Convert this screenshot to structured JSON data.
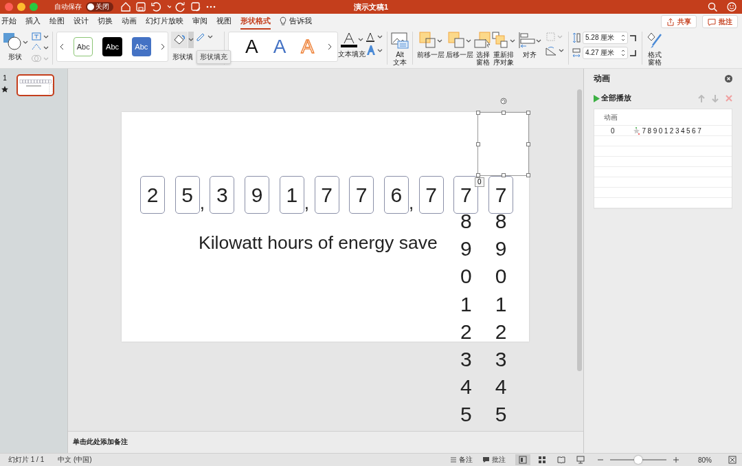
{
  "title_bar": {
    "autosave_label": "自动保存",
    "autosave": {
      "on": false,
      "text": "关闭"
    },
    "title": "演示文稿1"
  },
  "tabs": [
    {
      "label": "开始",
      "selected": false
    },
    {
      "label": "插入",
      "selected": false
    },
    {
      "label": "绘图",
      "selected": false
    },
    {
      "label": "设计",
      "selected": false
    },
    {
      "label": "切换",
      "selected": false
    },
    {
      "label": "动画",
      "selected": false
    },
    {
      "label": "幻灯片放映",
      "selected": false
    },
    {
      "label": "审阅",
      "selected": false
    },
    {
      "label": "视图",
      "selected": false
    },
    {
      "label": "形状格式",
      "selected": true
    },
    {
      "label": "告诉我",
      "selected": false
    }
  ],
  "actions": [
    {
      "label": "共享",
      "kind": "share"
    },
    {
      "label": "批注",
      "kind": "comment"
    }
  ],
  "ribbon": {
    "shape_label": "形状",
    "style_samples": [
      {
        "text": "Abc",
        "kind": "outline"
      },
      {
        "text": "Abc",
        "kind": "black"
      },
      {
        "text": "Abc",
        "kind": "blue"
      }
    ],
    "shape_fill": "形状填",
    "tooltip": "形状填充",
    "wordart_samples": [
      {
        "text": "A",
        "kind": "black"
      },
      {
        "text": "A",
        "kind": "blue"
      },
      {
        "text": "A",
        "kind": "orange"
      }
    ],
    "text_fill": "文本填充",
    "alt_text": "Alt 文本",
    "arrange": [
      {
        "label": "前移一层",
        "kind": "forward"
      },
      {
        "label": "后移一层",
        "kind": "backward"
      },
      {
        "label": "选择窗格",
        "kind": "select"
      },
      {
        "label": "重新排序对象",
        "kind": "reorder"
      },
      {
        "label": "对齐",
        "kind": "align"
      }
    ],
    "sizes": [
      {
        "value": "5.28 厘米",
        "kind": "height"
      },
      {
        "value": "4.27 厘米",
        "kind": "width"
      }
    ],
    "format_pane": "格式窗格"
  },
  "slides": [
    {
      "number": "1",
      "selected": true
    }
  ],
  "slide": {
    "counter": [
      {
        "kind": "digit",
        "text": "2"
      },
      {
        "kind": "digit",
        "text": "5"
      },
      {
        "kind": "comma",
        "text": ","
      },
      {
        "kind": "digit",
        "text": "3"
      },
      {
        "kind": "digit",
        "text": "9"
      },
      {
        "kind": "digit",
        "text": "1"
      },
      {
        "kind": "comma",
        "text": ","
      },
      {
        "kind": "digit",
        "text": "7"
      },
      {
        "kind": "digit",
        "text": "7"
      },
      {
        "kind": "digit",
        "text": "6"
      },
      {
        "kind": "comma",
        "text": ","
      },
      {
        "kind": "digit",
        "text": "7"
      },
      {
        "kind": "digit",
        "text": "7"
      },
      {
        "kind": "digit",
        "text": "7"
      }
    ],
    "rolling_columns": [
      [
        "8",
        "9",
        "0",
        "1",
        "2",
        "3",
        "4",
        "5"
      ],
      [
        "8",
        "9",
        "0",
        "1",
        "2",
        "3",
        "4",
        "5"
      ]
    ],
    "caption": "Kilowatt hours of energy save",
    "selection_badge": "0"
  },
  "notes": {
    "placeholder": "单击此处添加备注"
  },
  "animation_pane": {
    "title": "动画",
    "play_all": "全部播放",
    "column": "动画",
    "rows": [
      {
        "number": "0",
        "label": "78901234567"
      }
    ]
  },
  "status_bar": {
    "slide_count": "幻灯片 1 / 1",
    "language": "中文 (中国)",
    "notes": "备注",
    "comments": "批注",
    "views": [
      {
        "kind": "normal",
        "selected": true
      },
      {
        "kind": "sorter",
        "selected": false
      },
      {
        "kind": "reading",
        "selected": false
      },
      {
        "kind": "slideshow",
        "selected": false
      }
    ],
    "zoom": {
      "level": 0.5
    },
    "zoom_reading": "80%"
  }
}
